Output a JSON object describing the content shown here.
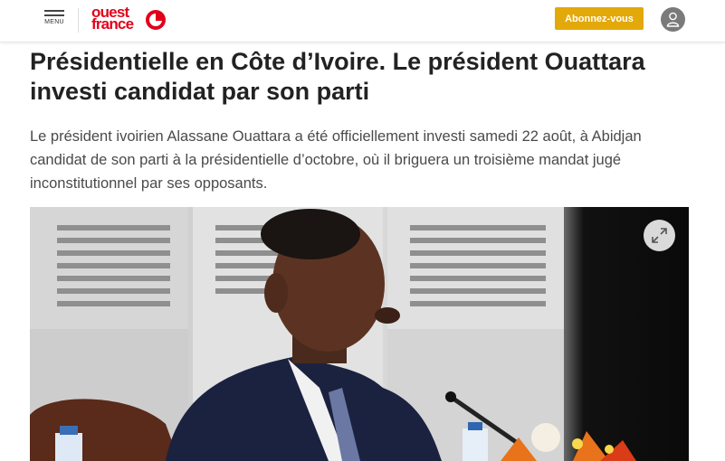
{
  "header": {
    "menu_label": "MENU",
    "logo_line1": "ouest",
    "logo_line2": "france",
    "subscribe_label": "Abonnez-vous",
    "brand_color": "#e2001a",
    "button_color": "#e3a80a"
  },
  "article": {
    "title": "Présidentielle en Côte d’Ivoire. Le président Ouattara investi candidat par son parti",
    "lead": "Le président ivoirien Alassane Ouattara a été officiellement investi samedi 22 août, à Abidjan candidat de son parti à la présidentielle d’octobre, où il briguera un troisième mandat jugé inconstitutionnel par ses opposants."
  },
  "icons": {
    "menu": "hamburger-icon",
    "account": "user-icon",
    "expand": "expand-icon"
  }
}
